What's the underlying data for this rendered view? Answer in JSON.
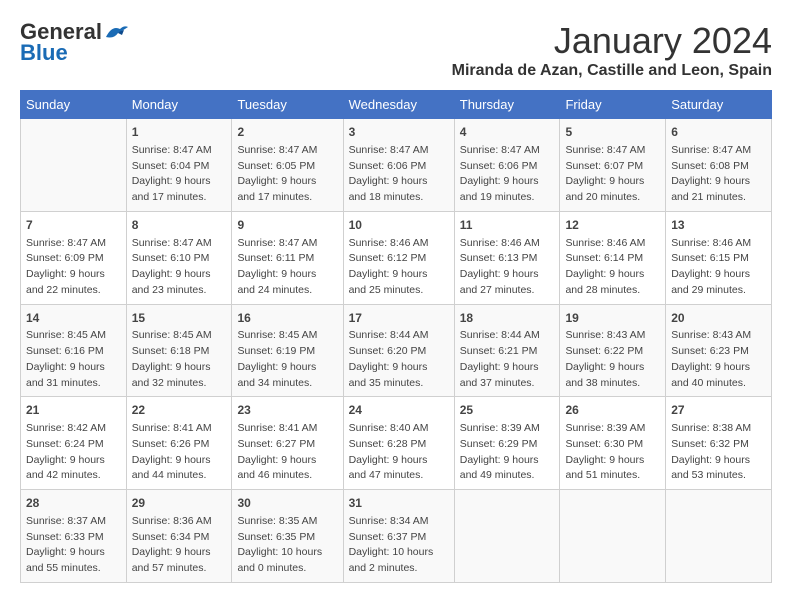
{
  "header": {
    "logo_general": "General",
    "logo_blue": "Blue",
    "main_title": "January 2024",
    "subtitle": "Miranda de Azan, Castille and Leon, Spain"
  },
  "calendar": {
    "days_of_week": [
      "Sunday",
      "Monday",
      "Tuesday",
      "Wednesday",
      "Thursday",
      "Friday",
      "Saturday"
    ],
    "weeks": [
      [
        {
          "day": "",
          "content": ""
        },
        {
          "day": "1",
          "content": "Sunrise: 8:47 AM\nSunset: 6:04 PM\nDaylight: 9 hours\nand 17 minutes."
        },
        {
          "day": "2",
          "content": "Sunrise: 8:47 AM\nSunset: 6:05 PM\nDaylight: 9 hours\nand 17 minutes."
        },
        {
          "day": "3",
          "content": "Sunrise: 8:47 AM\nSunset: 6:06 PM\nDaylight: 9 hours\nand 18 minutes."
        },
        {
          "day": "4",
          "content": "Sunrise: 8:47 AM\nSunset: 6:06 PM\nDaylight: 9 hours\nand 19 minutes."
        },
        {
          "day": "5",
          "content": "Sunrise: 8:47 AM\nSunset: 6:07 PM\nDaylight: 9 hours\nand 20 minutes."
        },
        {
          "day": "6",
          "content": "Sunrise: 8:47 AM\nSunset: 6:08 PM\nDaylight: 9 hours\nand 21 minutes."
        }
      ],
      [
        {
          "day": "7",
          "content": "Sunrise: 8:47 AM\nSunset: 6:09 PM\nDaylight: 9 hours\nand 22 minutes."
        },
        {
          "day": "8",
          "content": "Sunrise: 8:47 AM\nSunset: 6:10 PM\nDaylight: 9 hours\nand 23 minutes."
        },
        {
          "day": "9",
          "content": "Sunrise: 8:47 AM\nSunset: 6:11 PM\nDaylight: 9 hours\nand 24 minutes."
        },
        {
          "day": "10",
          "content": "Sunrise: 8:46 AM\nSunset: 6:12 PM\nDaylight: 9 hours\nand 25 minutes."
        },
        {
          "day": "11",
          "content": "Sunrise: 8:46 AM\nSunset: 6:13 PM\nDaylight: 9 hours\nand 27 minutes."
        },
        {
          "day": "12",
          "content": "Sunrise: 8:46 AM\nSunset: 6:14 PM\nDaylight: 9 hours\nand 28 minutes."
        },
        {
          "day": "13",
          "content": "Sunrise: 8:46 AM\nSunset: 6:15 PM\nDaylight: 9 hours\nand 29 minutes."
        }
      ],
      [
        {
          "day": "14",
          "content": "Sunrise: 8:45 AM\nSunset: 6:16 PM\nDaylight: 9 hours\nand 31 minutes."
        },
        {
          "day": "15",
          "content": "Sunrise: 8:45 AM\nSunset: 6:18 PM\nDaylight: 9 hours\nand 32 minutes."
        },
        {
          "day": "16",
          "content": "Sunrise: 8:45 AM\nSunset: 6:19 PM\nDaylight: 9 hours\nand 34 minutes."
        },
        {
          "day": "17",
          "content": "Sunrise: 8:44 AM\nSunset: 6:20 PM\nDaylight: 9 hours\nand 35 minutes."
        },
        {
          "day": "18",
          "content": "Sunrise: 8:44 AM\nSunset: 6:21 PM\nDaylight: 9 hours\nand 37 minutes."
        },
        {
          "day": "19",
          "content": "Sunrise: 8:43 AM\nSunset: 6:22 PM\nDaylight: 9 hours\nand 38 minutes."
        },
        {
          "day": "20",
          "content": "Sunrise: 8:43 AM\nSunset: 6:23 PM\nDaylight: 9 hours\nand 40 minutes."
        }
      ],
      [
        {
          "day": "21",
          "content": "Sunrise: 8:42 AM\nSunset: 6:24 PM\nDaylight: 9 hours\nand 42 minutes."
        },
        {
          "day": "22",
          "content": "Sunrise: 8:41 AM\nSunset: 6:26 PM\nDaylight: 9 hours\nand 44 minutes."
        },
        {
          "day": "23",
          "content": "Sunrise: 8:41 AM\nSunset: 6:27 PM\nDaylight: 9 hours\nand 46 minutes."
        },
        {
          "day": "24",
          "content": "Sunrise: 8:40 AM\nSunset: 6:28 PM\nDaylight: 9 hours\nand 47 minutes."
        },
        {
          "day": "25",
          "content": "Sunrise: 8:39 AM\nSunset: 6:29 PM\nDaylight: 9 hours\nand 49 minutes."
        },
        {
          "day": "26",
          "content": "Sunrise: 8:39 AM\nSunset: 6:30 PM\nDaylight: 9 hours\nand 51 minutes."
        },
        {
          "day": "27",
          "content": "Sunrise: 8:38 AM\nSunset: 6:32 PM\nDaylight: 9 hours\nand 53 minutes."
        }
      ],
      [
        {
          "day": "28",
          "content": "Sunrise: 8:37 AM\nSunset: 6:33 PM\nDaylight: 9 hours\nand 55 minutes."
        },
        {
          "day": "29",
          "content": "Sunrise: 8:36 AM\nSunset: 6:34 PM\nDaylight: 9 hours\nand 57 minutes."
        },
        {
          "day": "30",
          "content": "Sunrise: 8:35 AM\nSunset: 6:35 PM\nDaylight: 10 hours\nand 0 minutes."
        },
        {
          "day": "31",
          "content": "Sunrise: 8:34 AM\nSunset: 6:37 PM\nDaylight: 10 hours\nand 2 minutes."
        },
        {
          "day": "",
          "content": ""
        },
        {
          "day": "",
          "content": ""
        },
        {
          "day": "",
          "content": ""
        }
      ]
    ]
  }
}
